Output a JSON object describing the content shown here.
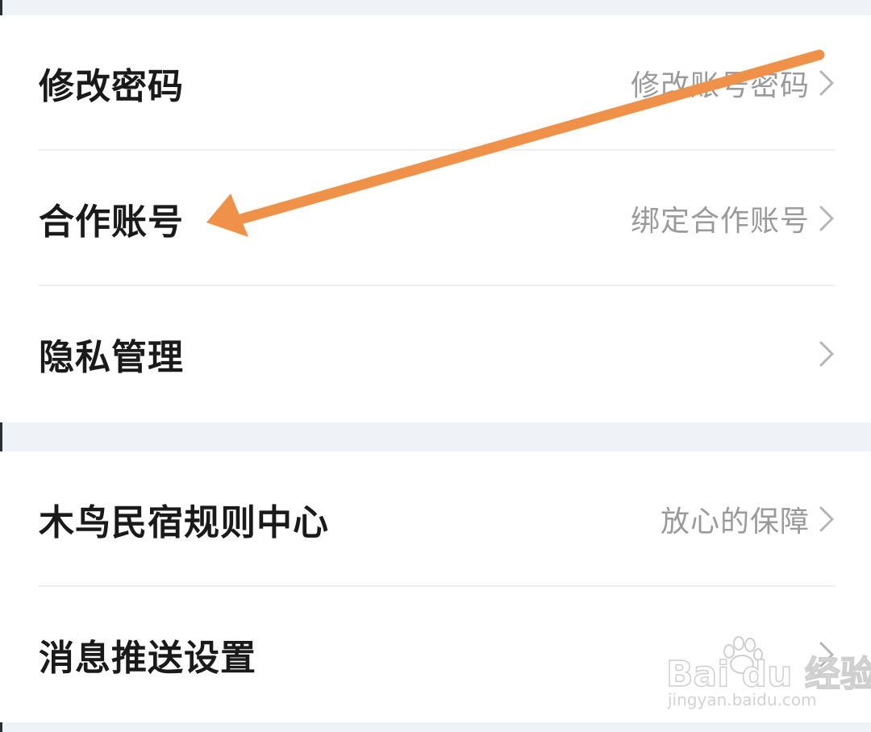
{
  "settings_group_1": {
    "items": [
      {
        "title": "修改密码",
        "value": "修改账号密码"
      },
      {
        "title": "合作账号",
        "value": "绑定合作账号"
      },
      {
        "title": "隐私管理",
        "value": ""
      }
    ]
  },
  "settings_group_2": {
    "items": [
      {
        "title": "木鸟民宿规则中心",
        "value": "放心的保障"
      },
      {
        "title": "消息推送设置",
        "value": ""
      }
    ]
  },
  "annotation": {
    "arrow_color": "#f0914a"
  },
  "watermark": {
    "brand": "Bai du 经验",
    "url": "jingyan.baidu.com"
  },
  "icons": {
    "chevron": "chevron-right-icon"
  },
  "colors": {
    "background": "#eff2f6",
    "card": "#ffffff",
    "title": "#1a1a1a",
    "value": "#9a9a9a"
  }
}
